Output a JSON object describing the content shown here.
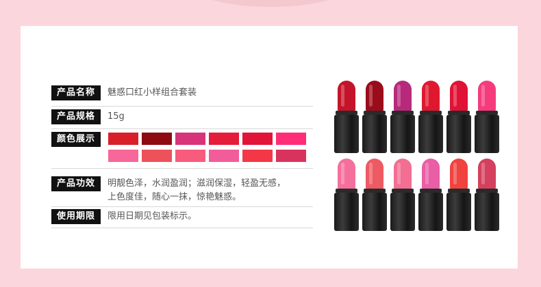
{
  "product": {
    "name_label": "产品名称",
    "name_value": "魅惑口红小样组合套装",
    "spec_label": "产品规格",
    "spec_value": "15g",
    "colors_label": "颜色展示",
    "effect_label": "产品功效",
    "effect_line1": "明靓色泽，水润盈润；滋润保湿，轻盈无感，",
    "effect_line2": "上色度佳，随心一抹，惊艳魅惑。",
    "expiry_label": "使用期限",
    "expiry_value": "限用日期见包装标示。"
  },
  "swatch_colors": [
    "#d91f2a",
    "#8e0b12",
    "#d8347c",
    "#e51c3a",
    "#e2143a",
    "#ff2d77",
    "#f7679a",
    "#ed525a",
    "#f95b7d",
    "#f25c9a",
    "#f43747",
    "#d8335d"
  ],
  "lipsticks_top": [
    "#c4142a",
    "#9b0c1a",
    "#b72a7b",
    "#e0182f",
    "#e01236",
    "#f53b7c"
  ],
  "lipsticks_bottom": [
    "#f56f9c",
    "#ee5a63",
    "#f26e92",
    "#e95ea5",
    "#f0433f",
    "#d4405d"
  ]
}
